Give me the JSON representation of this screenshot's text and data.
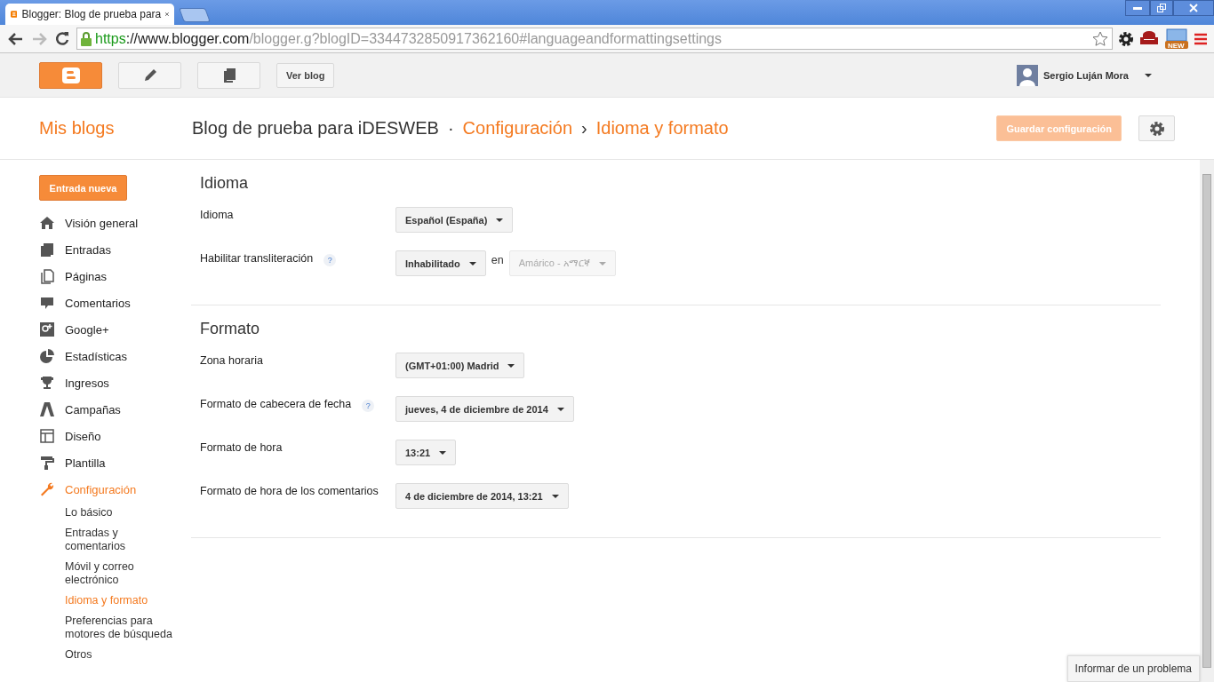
{
  "browser": {
    "new_badge": "NEW",
    "tab_title": "Blogger: Blog de prueba para",
    "url": {
      "scheme": "https",
      "host": "://www.blogger.com",
      "path": "/blogger.g?blogID=3344732850917362160#languageandformattingsettings"
    }
  },
  "topbar": {
    "view_blog": "Ver blog",
    "user": "Sergio Luján Mora"
  },
  "header": {
    "my_blogs": "Mis blogs",
    "blog_title": "Blog de prueba para iDESWEB",
    "separator": "·",
    "section": "Configuración",
    "arrow": "›",
    "page": "Idioma y formato",
    "save": "Guardar configuración",
    "save_disabled": true
  },
  "sidebar": {
    "new_post": "Entrada nueva",
    "items": [
      {
        "label": "Visión general",
        "kind": "home",
        "selected": false
      },
      {
        "label": "Entradas",
        "kind": "posts",
        "selected": false
      },
      {
        "label": "Páginas",
        "kind": "pages",
        "selected": false
      },
      {
        "label": "Comentarios",
        "kind": "comments",
        "selected": false
      },
      {
        "label": "Google+",
        "kind": "gplus",
        "selected": false
      },
      {
        "label": "Estadísticas",
        "kind": "stats",
        "selected": false
      },
      {
        "label": "Ingresos",
        "kind": "trophy",
        "selected": false
      },
      {
        "label": "Campañas",
        "kind": "campaigns",
        "selected": false
      },
      {
        "label": "Diseño",
        "kind": "layout",
        "selected": false
      },
      {
        "label": "Plantilla",
        "kind": "roller",
        "selected": false
      },
      {
        "label": "Configuración",
        "kind": "wrench",
        "selected": true,
        "children": [
          {
            "label": "Lo básico",
            "selected": false
          },
          {
            "label": "Entradas y comentarios",
            "selected": false
          },
          {
            "label": "Móvil y correo electrónico",
            "selected": false
          },
          {
            "label": "Idioma y formato",
            "selected": true
          },
          {
            "label": "Preferencias para motores de búsqueda",
            "selected": false
          },
          {
            "label": "Otros",
            "selected": false
          }
        ]
      }
    ]
  },
  "sections": [
    {
      "title": "Idioma",
      "rows": [
        {
          "label": "Idioma",
          "select": {
            "value": "Español (España)",
            "disabled": false
          }
        },
        {
          "label": "Habilitar transliteración",
          "help_text": "?",
          "select": {
            "value": "Inhabilitado",
            "disabled": false
          },
          "joiner": "en",
          "select2": {
            "value": "Amárico - አማርኛ",
            "disabled": true
          }
        }
      ]
    },
    {
      "title": "Formato",
      "rows": [
        {
          "label": "Zona horaria",
          "select": {
            "value": "(GMT+01:00) Madrid",
            "disabled": false
          }
        },
        {
          "label": "Formato de cabecera de fecha",
          "help_text": "?",
          "select": {
            "value": "jueves, 4 de diciembre de 2014",
            "disabled": false
          }
        },
        {
          "label": "Formato de hora",
          "select": {
            "value": "13:21",
            "disabled": false
          }
        },
        {
          "label": "Formato de hora de los comentarios",
          "select": {
            "value": "4 de diciembre de 2014, 13:21",
            "disabled": false
          }
        }
      ]
    }
  ],
  "report": "Informar de un problema"
}
